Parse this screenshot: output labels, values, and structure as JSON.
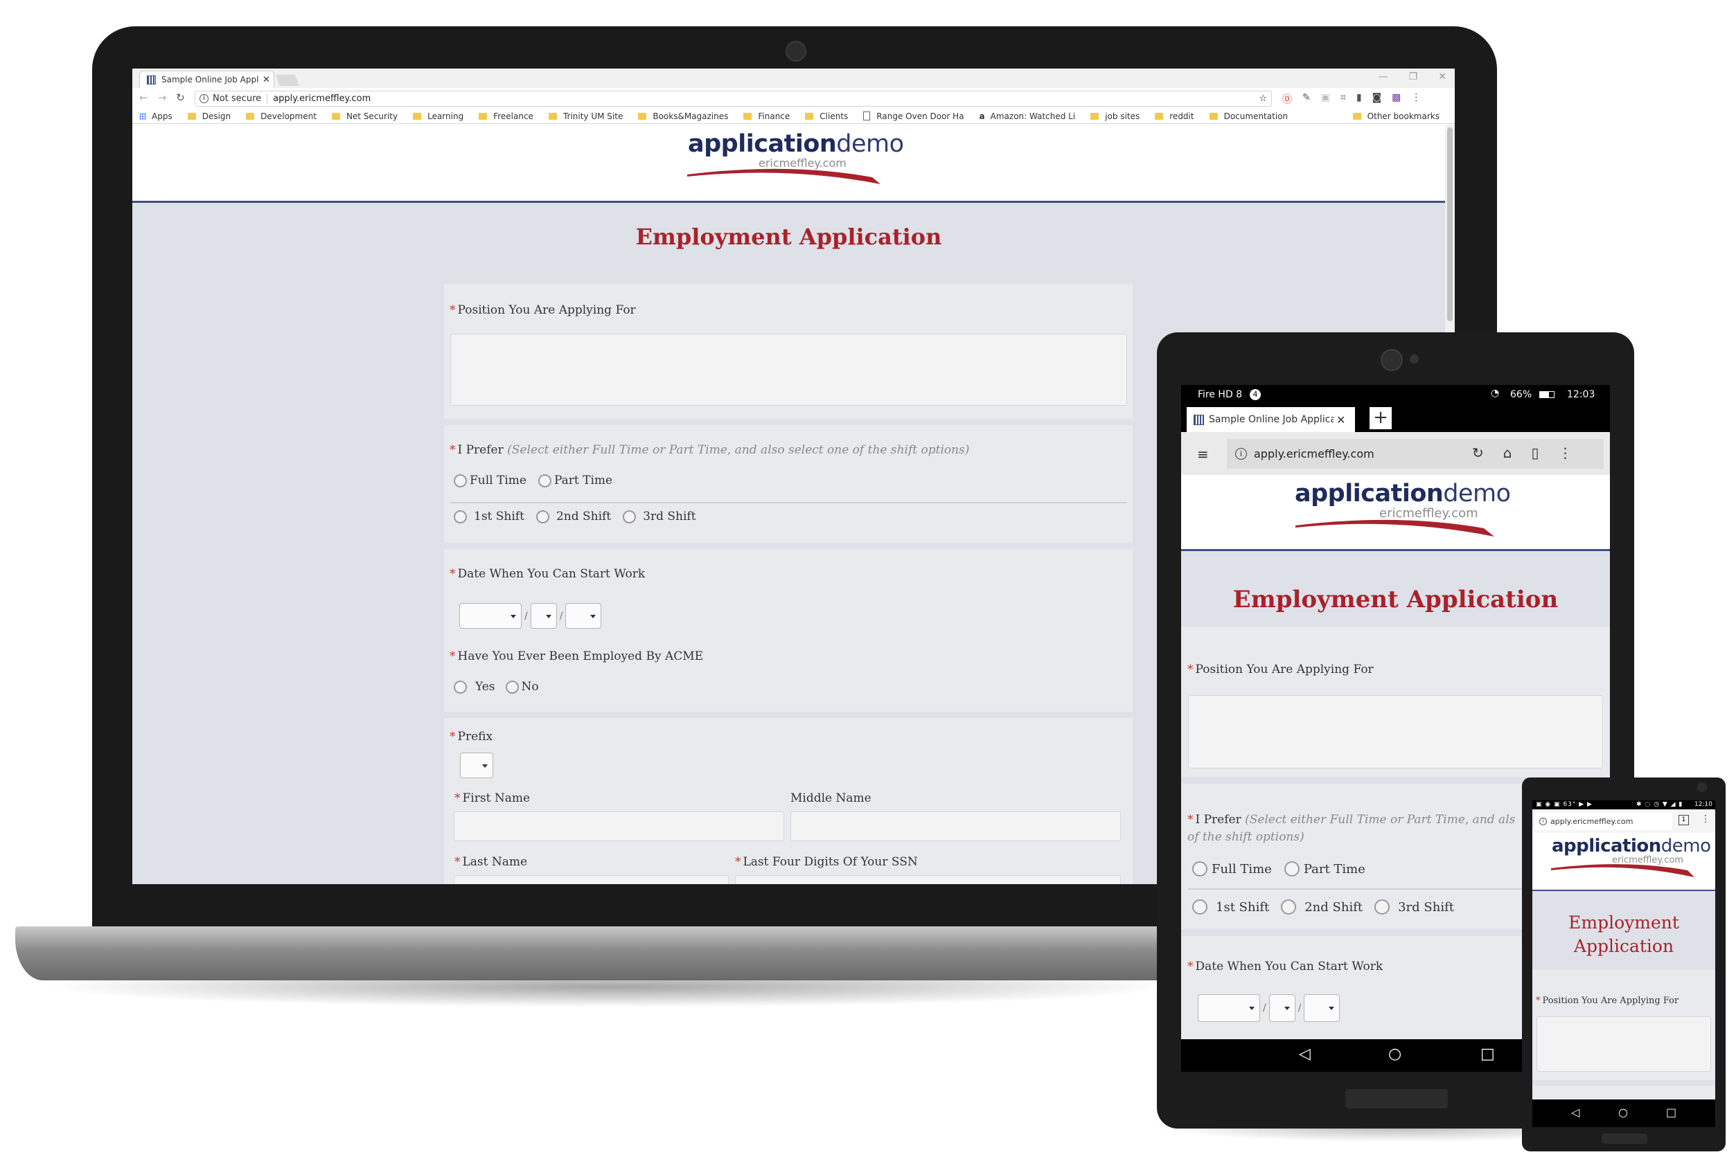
{
  "browser": {
    "tab_title": "Sample Online Job Appl",
    "security": "Not secure",
    "url": "apply.ericmeffley.com",
    "bookmarks": [
      "Apps",
      "Design",
      "Development",
      "Net Security",
      "Learning",
      "Freelance",
      "Trinity UM Site",
      "Books&Magazines",
      "Finance",
      "Clients",
      "Range Oven Door Ha",
      "Amazon: Watched Li",
      "job sites",
      "reddit",
      "Documentation"
    ],
    "other_bookmarks": "Other bookmarks"
  },
  "logo": {
    "main": "application",
    "accent": "demo",
    "sub": "ericmeffley.com"
  },
  "form": {
    "title": "Employment Application",
    "position_label": "Position You Are Applying For",
    "prefer_label": "I Prefer",
    "prefer_hint": "(Select either Full Time or Part Time, and also select one of the shift options)",
    "full_time": "Full Time",
    "part_time": "Part Time",
    "shift1": "1st Shift",
    "shift2": "2nd Shift",
    "shift3": "3rd Shift",
    "start_date_label": "Date When You Can Start Work",
    "date_sep": "/",
    "employed_label": "Have You Ever Been Employed By ACME",
    "yes": "Yes",
    "no": "No",
    "prefix_label": "Prefix",
    "first_name_label": "First Name",
    "middle_name_label": "Middle Name",
    "last_name_label": "Last Name",
    "ssn_label": "Last Four Digits Of Your SSN"
  },
  "tablet": {
    "device_name": "Fire HD 8",
    "notif_count": "4",
    "battery": "66%",
    "time": "12:03",
    "tab_title": "Sample Online Job Applicatio",
    "url": "apply.ericmeffley.com",
    "prefer_hint_line1": "(Select either Full Time or Part Time, and als",
    "prefer_hint_line2": "of the shift options)"
  },
  "phone": {
    "time": "12:10",
    "status_temp": "63°",
    "url": "apply.ericmeffley.com",
    "title_line1": "Employment",
    "title_line2": "Application"
  }
}
